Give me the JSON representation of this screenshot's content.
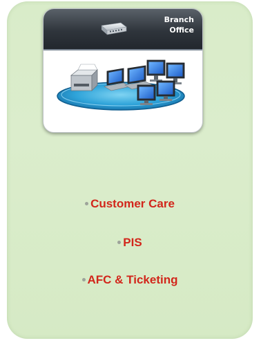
{
  "card": {
    "title": "Branch\nOffice",
    "icons": [
      "router-icon",
      "printer-icon",
      "laptop-icon",
      "monitor-icon",
      "network-platform-icon"
    ]
  },
  "bullets": [
    {
      "label": "Customer Care"
    },
    {
      "label": "PIS"
    },
    {
      "label": "AFC & Ticketing"
    }
  ],
  "colors": {
    "panel_bg": "#d9ecc9",
    "bullet_text": "#d2261b",
    "header_bg": "#2f353c"
  }
}
